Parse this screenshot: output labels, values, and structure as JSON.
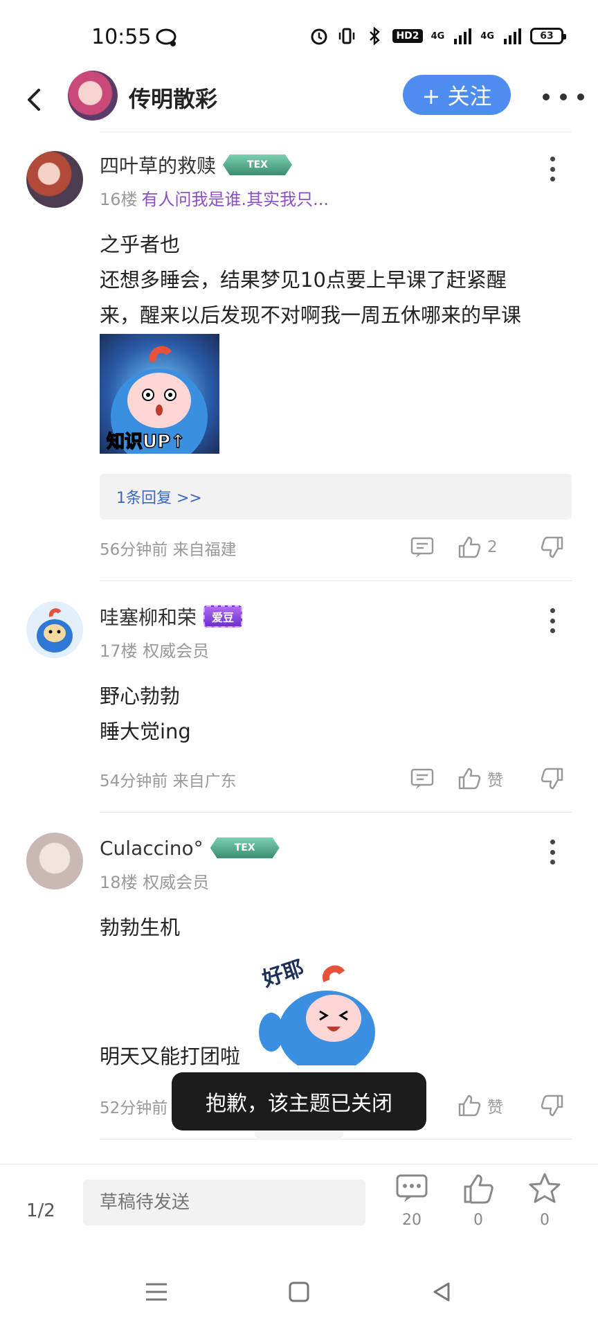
{
  "status_bar": {
    "time": "10:55",
    "hd_label": "HD2",
    "sig1": "4G",
    "sig2": "4G",
    "battery": "63"
  },
  "header": {
    "title": "传明散彩",
    "follow_label": "+ 关注"
  },
  "posts": [
    {
      "username": "四叶草的救赎",
      "badge": "TEX",
      "floor": "16楼",
      "signature": "有人问我是谁.其实我只...",
      "lines": [
        "之乎者也",
        "还想多睡会，结果梦见10点要上早课了赶紧醒",
        "来，醒来以后发现不对啊我一周五休哪来的早课"
      ],
      "sticker_text": "知识UP↑",
      "reply_label": "1条回复 >>",
      "time_loc": "56分钟前 来自福建",
      "like_label": "2"
    },
    {
      "username": "哇塞柳和荣",
      "badge": "爱豆",
      "floor": "17楼",
      "signature": "权威会员",
      "lines": [
        "野心勃勃",
        "睡大觉ing"
      ],
      "time_loc": "54分钟前 来自广东",
      "like_label": "赞"
    },
    {
      "username": "Culaccino°",
      "badge": "TEX",
      "floor": "18楼",
      "signature": "权威会员",
      "lines": [
        "勃勃生机"
      ],
      "sticker_text": "好耶",
      "extra_line": "明天又能打团啦",
      "time_loc": "52分钟前",
      "like_label": "赞"
    }
  ],
  "toast": "抱歉，该主题已关闭",
  "bottom_bar": {
    "page_indicator": "1/2",
    "draft_placeholder": "草稿待发送",
    "comment_count": "20",
    "like_count": "0",
    "star_count": "0"
  },
  "icons": [
    "back-icon",
    "more-icon",
    "kebab-icon",
    "comment-icon",
    "thumb-up-icon",
    "thumb-down-icon",
    "star-icon",
    "menu-icon",
    "home-icon",
    "back-triangle-icon"
  ],
  "colors": {
    "accent": "#4f8cf0",
    "signature_link": "#8a4fc8",
    "reply_link": "#3a66c4"
  }
}
